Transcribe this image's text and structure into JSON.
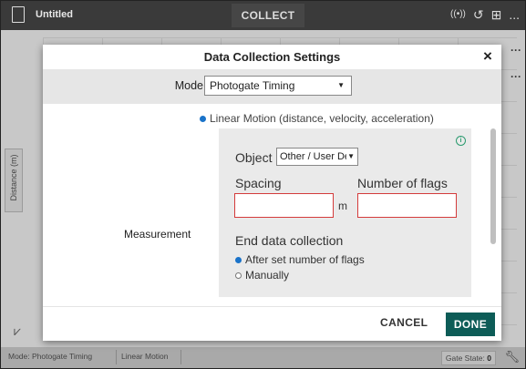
{
  "app": {
    "document_title": "Untitled",
    "center_tab": "COLLECT",
    "more_icon": "...",
    "y_axis_label": "Distance (m)"
  },
  "status": {
    "mode": "Mode: Photogate Timing",
    "motion": "Linear Motion",
    "gate_label": "Gate State:",
    "gate_value": "0"
  },
  "dialog": {
    "title": "Data Collection Settings",
    "close": "×",
    "mode_label": "Mode",
    "mode_value": "Photogate Timing",
    "motion_option": "Linear Motion (distance, velocity, acceleration)",
    "measurement_label": "Measurement",
    "object_label": "Object",
    "object_value": "Other / User Defi",
    "spacing_label": "Spacing",
    "spacing_unit": "m",
    "flags_label": "Number of flags",
    "end_label": "End data collection",
    "end_options": [
      "After set number of flags",
      "Manually"
    ],
    "cancel": "CANCEL",
    "done": "DONE"
  },
  "colors": {
    "accent": "#0d5c57",
    "radio": "#1a73c9",
    "error_border": "#d43b3b",
    "info": "#2a9a6e"
  },
  "icons": [
    "document-icon",
    "sensor-icon",
    "refresh-icon",
    "layout-icon",
    "more-icon",
    "graph-icon",
    "wrench-icon",
    "info-icon"
  ]
}
